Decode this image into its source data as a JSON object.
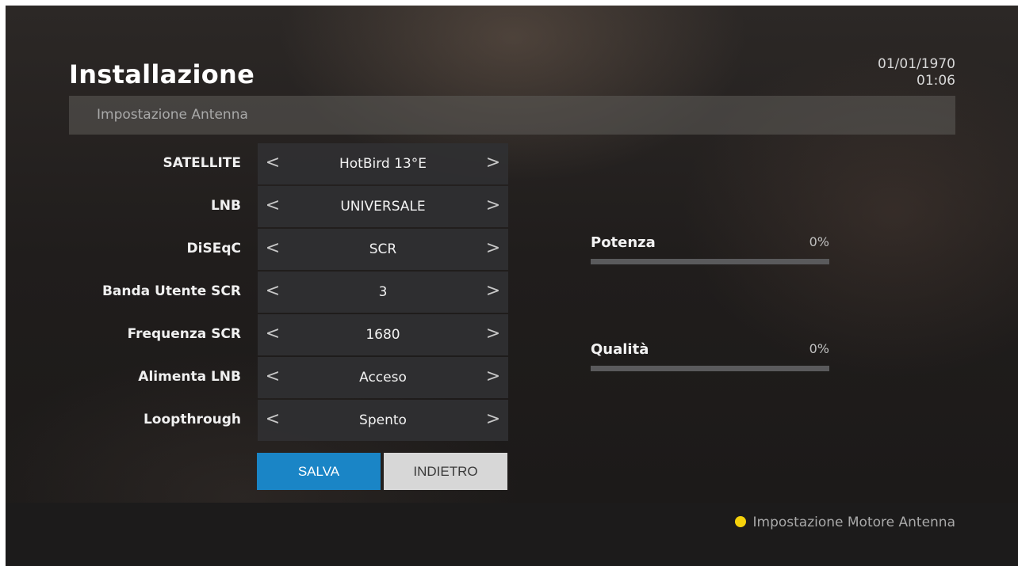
{
  "header": {
    "title": "Installazione",
    "date": "01/01/1970",
    "time": "01:06"
  },
  "subheader": {
    "label": "Impostazione Antenna"
  },
  "settings": [
    {
      "label": "SATELLITE",
      "value": "HotBird 13°E"
    },
    {
      "label": "LNB",
      "value": "UNIVERSALE"
    },
    {
      "label": "DiSEqC",
      "value": "SCR"
    },
    {
      "label": "Banda Utente SCR",
      "value": "3"
    },
    {
      "label": "Frequenza SCR",
      "value": "1680"
    },
    {
      "label": "Alimenta LNB",
      "value": "Acceso"
    },
    {
      "label": "Loopthrough",
      "value": "Spento"
    }
  ],
  "arrows": {
    "left": "<",
    "right": ">"
  },
  "buttons": {
    "save": "SALVA",
    "back": "INDIETRO"
  },
  "meters": {
    "power": {
      "label": "Potenza",
      "value_text": "0%",
      "level": 0
    },
    "quality": {
      "label": "Qualità",
      "value_text": "0%",
      "level": 0
    }
  },
  "footer": {
    "hint": "Impostazione Motore Antenna",
    "hint_color": "#f5d10b"
  },
  "colors": {
    "accent": "#1a85c6",
    "background": "#201d1c"
  }
}
